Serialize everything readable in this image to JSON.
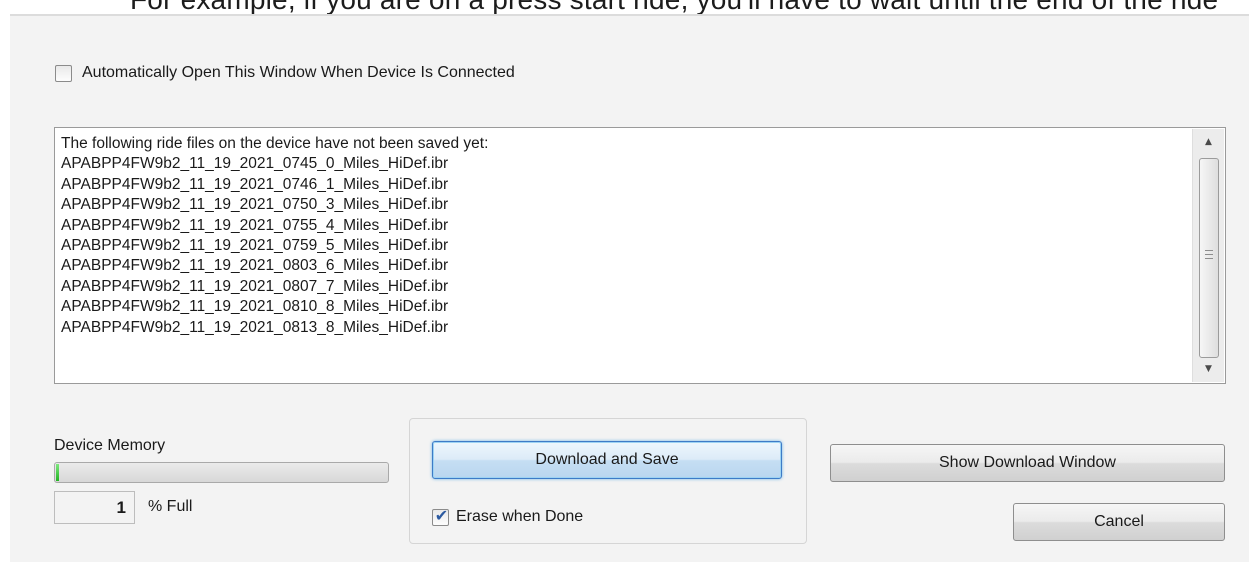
{
  "top_fragment": "For example, if you are on a press start ride, you'll have to wait until the end of the ride",
  "dialog": {
    "auto_open": {
      "label": "Automatically Open This Window When Device Is Connected",
      "checked": false
    },
    "file_list": {
      "header": "The following ride files on the device have not been saved yet:",
      "files": [
        "APABPP4FW9b2_11_19_2021_0745_0_Miles_HiDef.ibr",
        "APABPP4FW9b2_11_19_2021_0746_1_Miles_HiDef.ibr",
        "APABPP4FW9b2_11_19_2021_0750_3_Miles_HiDef.ibr",
        "APABPP4FW9b2_11_19_2021_0755_4_Miles_HiDef.ibr",
        "APABPP4FW9b2_11_19_2021_0759_5_Miles_HiDef.ibr",
        "APABPP4FW9b2_11_19_2021_0803_6_Miles_HiDef.ibr",
        "APABPP4FW9b2_11_19_2021_0807_7_Miles_HiDef.ibr",
        "APABPP4FW9b2_11_19_2021_0810_8_Miles_HiDef.ibr",
        "APABPP4FW9b2_11_19_2021_0813_8_Miles_HiDef.ibr"
      ]
    },
    "device_memory": {
      "label": "Device Memory",
      "percent_value": "1",
      "percent_suffix": "% Full",
      "fill_percent": 1
    },
    "download_save_label": "Download and Save",
    "erase_when_done": {
      "label": "Erase when Done",
      "checked": true
    },
    "show_download_window_label": "Show Download Window",
    "cancel_label": "Cancel"
  },
  "colors": {
    "progress_fill": "#22b322",
    "primary_focus": "#3d7bc7",
    "checkmark": "#2c5aa0"
  }
}
